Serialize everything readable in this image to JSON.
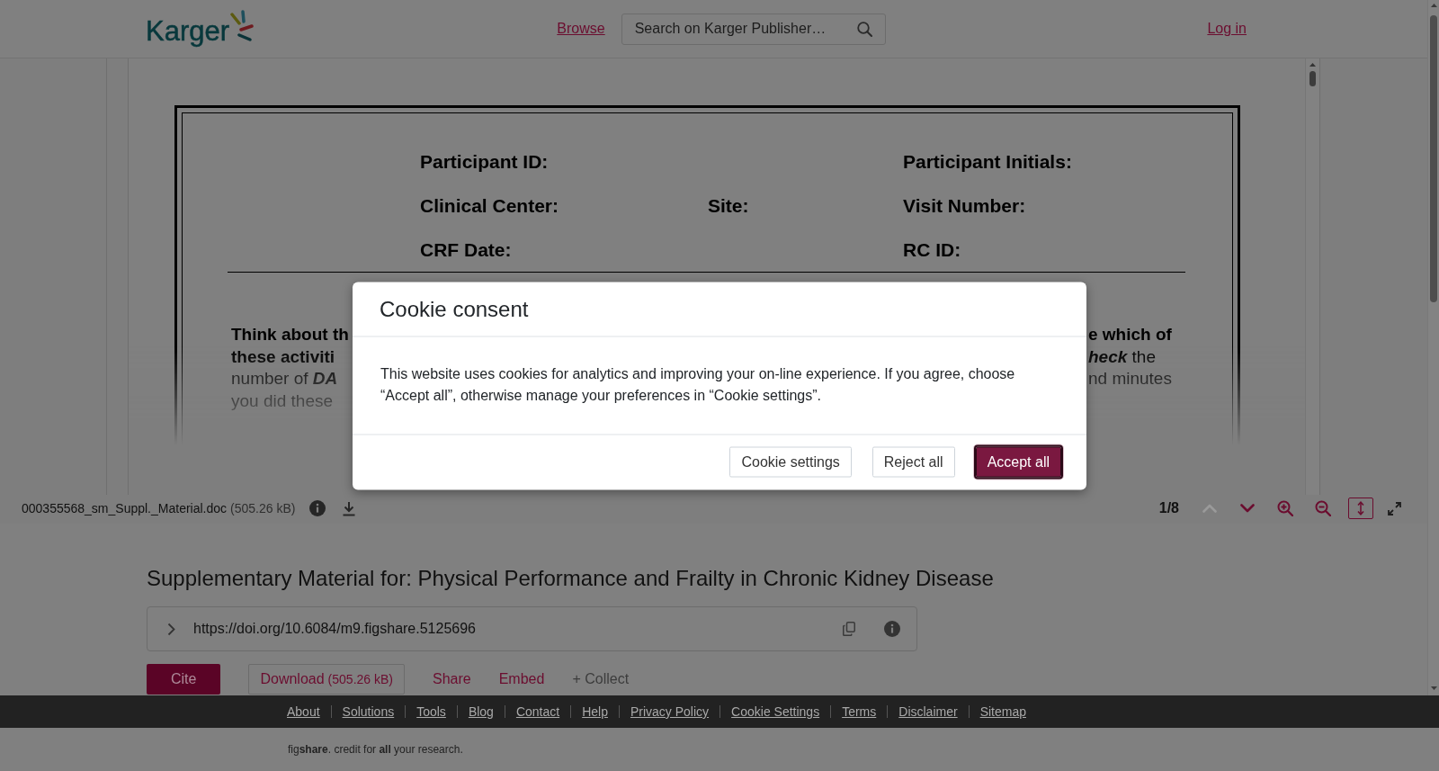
{
  "header": {
    "logo": "Karger",
    "nav_link": "Browse",
    "search": {
      "placeholder": "Search on Karger Publisher…"
    },
    "login": "Log in"
  },
  "document": {
    "form_rows": [
      {
        "left": "Participant ID:",
        "right": "Participant Initials:"
      },
      {
        "left": "Clinical Center:",
        "middle": "Site:",
        "right": "Visit Number:"
      },
      {
        "left": "CRF Date:",
        "right": "RC ID:"
      }
    ],
    "passage_lines": [
      {
        "left": "**Think about th**",
        "right": "**e which of**"
      },
      {
        "left": "**these activiti**",
        "right": "*heck* the"
      },
      {
        "left": "number of *DA*",
        "right": "nd minutes"
      },
      {
        "left": "you did these"
      }
    ]
  },
  "viewer_toolbar": {
    "file_name": "000355568_sm_Suppl._Material.doc",
    "file_size": "(505.26 kB)",
    "page": "1/8",
    "controls": [
      {
        "kind": "previous",
        "disabled": true,
        "selected": false
      },
      {
        "kind": "next",
        "disabled": false,
        "selected": false
      },
      {
        "kind": "zoomin",
        "disabled": false,
        "selected": false
      },
      {
        "kind": "zoomout",
        "disabled": false,
        "selected": false
      },
      {
        "kind": "fit",
        "disabled": false,
        "selected": true
      },
      {
        "kind": "fullscreen",
        "disabled": false,
        "selected": false
      }
    ]
  },
  "item": {
    "title": "Supplementary Material for: Physical Performance and Frailty in Chronic Kidney Disease",
    "doi": "https://doi.org/10.6084/m9.figshare.5125696",
    "actions": [
      {
        "kind": "primary",
        "label": "Cite"
      },
      {
        "kind": "outlined",
        "label": "Download",
        "note": "(505.26 kB)"
      },
      {
        "kind": "link",
        "label": "Share"
      },
      {
        "kind": "link",
        "label": "Embed"
      },
      {
        "kind": "muted",
        "label": "+ Collect"
      }
    ]
  },
  "footer": {
    "links": [
      "About",
      "Solutions",
      "Tools",
      "Blog",
      "Contact",
      "Help",
      "Privacy Policy",
      "Cookie Settings",
      "Terms",
      "Disclaimer",
      "Sitemap"
    ],
    "tagline": "fig**share**. credit for **all** your research."
  },
  "cookie_dialog": {
    "title": "Cookie consent",
    "message": "This website uses cookies for analytics and improving your on-line experience. If you agree, choose “Accept all”, otherwise manage your preferences in “Cookie settings”.",
    "buttons": [
      {
        "kind": "secondary",
        "label": "Cookie settings",
        "focused": false
      },
      {
        "kind": "secondary",
        "label": "Reject all",
        "focused": false
      },
      {
        "kind": "primary",
        "label": "Accept all",
        "focused": true
      }
    ]
  }
}
